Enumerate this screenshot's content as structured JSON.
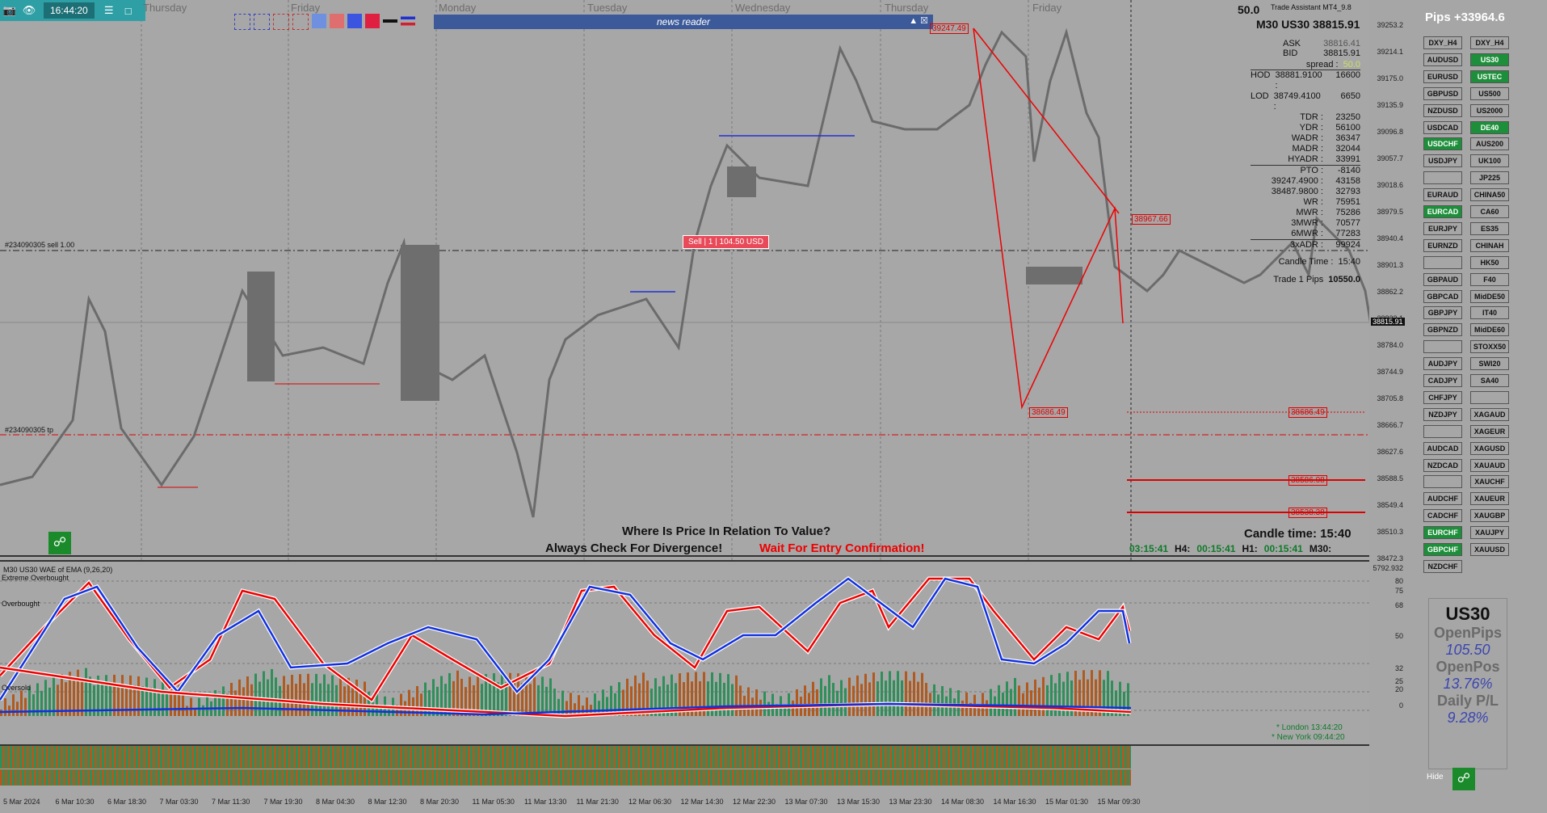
{
  "toolbar": {
    "time": "16:44:20"
  },
  "news": {
    "title": "news reader"
  },
  "days": [
    "Thursday",
    "Friday",
    "Monday",
    "Tuesday",
    "Wednesday",
    "Thursday",
    "Friday"
  ],
  "header": {
    "spread_value": "50.0",
    "app": "Trade Assistant MT4_9.8",
    "symbol_price": "M30 US30 38815.91"
  },
  "info": {
    "ask_label": "ASK",
    "ask": "38816.41",
    "bid_label": "BID",
    "bid": "38815.91",
    "spread_label": "spread :",
    "spread": "50.0",
    "rows": [
      [
        "HOD",
        "38881.9100 :",
        "16600"
      ],
      [
        "LOD",
        "38749.4100 :",
        "6650"
      ],
      [
        "",
        "TDR :",
        "23250"
      ],
      [
        "",
        "YDR :",
        "56100"
      ],
      [
        "",
        "WADR :",
        "36347"
      ],
      [
        "",
        "MADR :",
        "32044"
      ],
      [
        "",
        "HYADR :",
        "33991"
      ],
      [
        "",
        "PTO :",
        "-8140"
      ],
      [
        "",
        "39247.4900 :",
        "43158"
      ],
      [
        "",
        "38487.9800 :",
        "32793"
      ],
      [
        "",
        "WR :",
        "75951"
      ],
      [
        "",
        "MWR :",
        "75286"
      ],
      [
        "",
        "3MWR :",
        "70577"
      ],
      [
        "",
        "6MWR :",
        "77283"
      ],
      [
        "",
        "3xADR :",
        "99924"
      ]
    ],
    "candle_label": "Candle Time :",
    "candle_val": "15:40",
    "trade_label": "Trade 1 Pips",
    "trade_val": "10550.0"
  },
  "price_axis": [
    "39253.2",
    "39214.1",
    "39175.0",
    "39135.9",
    "39096.8",
    "39057.7",
    "39018.6",
    "38979.5",
    "38940.4",
    "38901.3",
    "38862.2",
    "38823.1",
    "38784.0",
    "38744.9",
    "38705.8",
    "38666.7",
    "38627.6",
    "38588.5",
    "38549.4",
    "38510.3",
    "38472.3"
  ],
  "current_price": "38815.91",
  "price_labels": {
    "top": "39247.49",
    "mid": "38967.66",
    "low": "38686.49",
    "r1": "38686.49",
    "r2": "38586.08",
    "r3": "38538.38"
  },
  "sell_box": "Sell | 1 | 104.50 USD",
  "order_lines": {
    "sell": "#234090305 sell 1.00",
    "tp": "#234090305 tp"
  },
  "center_text": {
    "line1": "Where Is Price In Relation To Value?",
    "line2": "Always Check For Divergence!",
    "line3": "Wait For Entry Confirmation!"
  },
  "candle_time": "Candle time:  15:40",
  "timers": {
    "t1": "03:15:41",
    "h4_label": "H4:",
    "h4": "00:15:41",
    "h1_label": "H1:",
    "h1": "00:15:41",
    "m30": "M30:"
  },
  "indicator": {
    "title": "M30 US30 WAE of EMA (9,26,20)",
    "levels": [
      "Extreme Overbought",
      "Overbought",
      "Oversold"
    ],
    "axis": [
      "5792.932",
      "80",
      "75",
      "68",
      "50",
      "32",
      "25",
      "20",
      "0"
    ],
    "london": "* London   13:44:20",
    "newyork": "* New York   09:44:20"
  },
  "xaxis": [
    "5 Mar 2024",
    "6 Mar 10:30",
    "6 Mar 18:30",
    "7 Mar 03:30",
    "7 Mar 11:30",
    "7 Mar 19:30",
    "8 Mar 04:30",
    "8 Mar 12:30",
    "8 Mar 20:30",
    "11 Mar 05:30",
    "11 Mar 13:30",
    "11 Mar 21:30",
    "12 Mar 06:30",
    "12 Mar 14:30",
    "12 Mar 22:30",
    "13 Mar 07:30",
    "13 Mar 15:30",
    "13 Mar 23:30",
    "14 Mar 08:30",
    "14 Mar 16:30",
    "15 Mar 01:30",
    "15 Mar 09:30"
  ],
  "sidebar": {
    "pips": "Pips +33964.6",
    "left": [
      [
        "DXY_H4",
        ""
      ],
      [
        "AUDUSD",
        ""
      ],
      [
        "EURUSD",
        ""
      ],
      [
        "GBPUSD",
        ""
      ],
      [
        "NZDUSD",
        ""
      ],
      [
        "USDCAD",
        ""
      ],
      [
        "USDCHF",
        "green"
      ],
      [
        "USDJPY",
        ""
      ],
      [
        "",
        ""
      ],
      [
        "EURAUD",
        ""
      ],
      [
        "EURCAD",
        "green"
      ],
      [
        "EURJPY",
        ""
      ],
      [
        "EURNZD",
        ""
      ],
      [
        "",
        ""
      ],
      [
        "GBPAUD",
        ""
      ],
      [
        "GBPCAD",
        ""
      ],
      [
        "GBPJPY",
        ""
      ],
      [
        "GBPNZD",
        ""
      ],
      [
        "",
        ""
      ],
      [
        "AUDJPY",
        ""
      ],
      [
        "CADJPY",
        ""
      ],
      [
        "CHFJPY",
        ""
      ],
      [
        "NZDJPY",
        ""
      ],
      [
        "",
        ""
      ],
      [
        "AUDCAD",
        ""
      ],
      [
        "NZDCAD",
        ""
      ],
      [
        "",
        ""
      ],
      [
        "AUDCHF",
        ""
      ],
      [
        "CADCHF",
        ""
      ],
      [
        "EURCHF",
        "green"
      ],
      [
        "GBPCHF",
        "green"
      ],
      [
        "NZDCHF",
        ""
      ]
    ],
    "right": [
      [
        "DXY_H4",
        ""
      ],
      [
        "US30",
        "green"
      ],
      [
        "USTEC",
        "green"
      ],
      [
        "US500",
        ""
      ],
      [
        "US2000",
        ""
      ],
      [
        "DE40",
        "green"
      ],
      [
        "AUS200",
        ""
      ],
      [
        "UK100",
        ""
      ],
      [
        "JP225",
        ""
      ],
      [
        "CHINA50",
        ""
      ],
      [
        "CA60",
        ""
      ],
      [
        "ES35",
        ""
      ],
      [
        "CHINAH",
        ""
      ],
      [
        "HK50",
        ""
      ],
      [
        "F40",
        ""
      ],
      [
        "MidDE50",
        ""
      ],
      [
        "IT40",
        ""
      ],
      [
        "MidDE60",
        ""
      ],
      [
        "STOXX50",
        ""
      ],
      [
        "SWI20",
        ""
      ],
      [
        "SA40",
        ""
      ],
      [
        "",
        ""
      ],
      [
        "XAGAUD",
        ""
      ],
      [
        "XAGEUR",
        ""
      ],
      [
        "XAGUSD",
        ""
      ],
      [
        "XAUAUD",
        ""
      ],
      [
        "XAUCHF",
        ""
      ],
      [
        "XAUEUR",
        ""
      ],
      [
        "XAUGBP",
        ""
      ],
      [
        "XAUJPY",
        ""
      ],
      [
        "XAUUSD",
        ""
      ]
    ],
    "panel": {
      "symbol": "US30",
      "openpips_label": "OpenPips",
      "openpips": "105.50",
      "openpos_label": "OpenPos",
      "openpos": "13.76%",
      "daily_label": "Daily P/L",
      "daily": "9.28%"
    },
    "hide": "Hide"
  },
  "colors": {
    "green": "#1d8f3a",
    "red": "#e00000",
    "blue": "#1030e0",
    "bg": "#a7a7a7"
  }
}
